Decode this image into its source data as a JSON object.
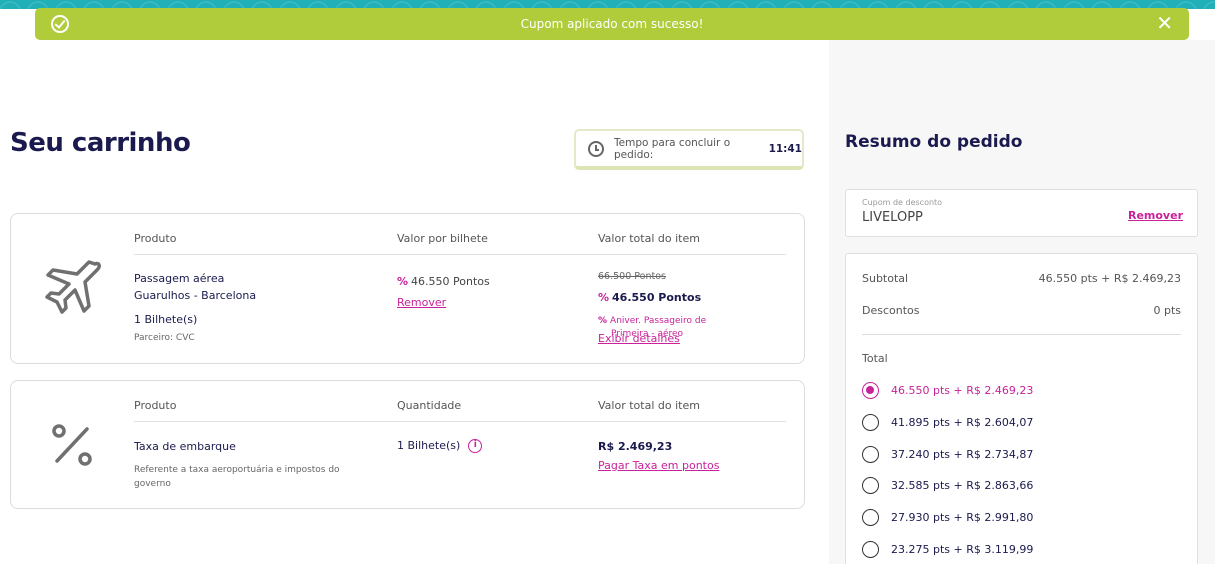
{
  "toast": {
    "message": "Cupom aplicado com sucesso!",
    "close": "✕"
  },
  "cart": {
    "title": "Seu carrinho"
  },
  "timer": {
    "label": "Tempo para concluir o pedido:",
    "value": "11:41"
  },
  "item1": {
    "head_product": "Produto",
    "head_unit": "Valor por bilhete",
    "head_total": "Valor total do item",
    "product_line1": "Passagem aérea",
    "product_line2": "Guarulhos - Barcelona",
    "tickets": "1 Bilhete(s)",
    "partner": "Parceiro: CVC",
    "unit_value": "46.550 Pontos",
    "remove": "Remover",
    "old_total": "66.500 Pontos",
    "total": "46.550 Pontos",
    "promo_line1": "Aniver. Passageiro de",
    "promo_line2": "Primeira - aéreo",
    "details": "Exibir detalhes"
  },
  "item2": {
    "head_product": "Produto",
    "head_qty": "Quantidade",
    "head_total": "Valor total do item",
    "product": "Taxa de embarque",
    "desc_line1": "Referente a taxa aeroportuária e impostos do",
    "desc_line2": "governo",
    "qty": "1 Bilhete(s)",
    "total": "R$ 2.469,23",
    "pay_points": "Pagar Taxa em pontos"
  },
  "summary": {
    "title": "Resumo do pedido",
    "coupon_label": "Cupom de desconto",
    "coupon_value": "LIVELOPP",
    "coupon_remove": "Remover",
    "subtotal_label": "Subtotal",
    "subtotal_value": "46.550 pts + R$ 2.469,23",
    "discount_label": "Descontos",
    "discount_value": "0 pts",
    "total_label": "Total",
    "options": [
      "46.550 pts + R$ 2.469,23",
      "41.895 pts + R$ 2.604,07",
      "37.240 pts + R$ 2.734,87",
      "32.585 pts + R$ 2.863,66",
      "27.930 pts + R$ 2.991,80",
      "23.275 pts + R$ 3.119,99"
    ]
  },
  "colors": {
    "accent": "#c8239a",
    "toast": "#b1cc3b",
    "title": "#1a1a4e"
  }
}
